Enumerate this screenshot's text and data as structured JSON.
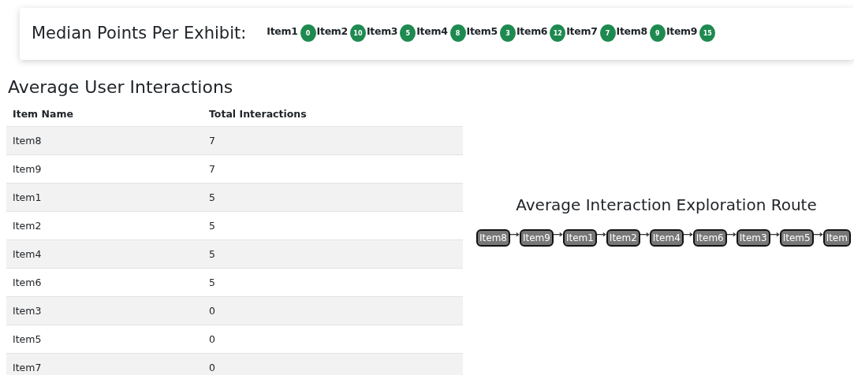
{
  "median_card": {
    "title": "Median Points Per Exhibit:",
    "items": [
      {
        "label": "Item1",
        "points": "0"
      },
      {
        "label": "Item2",
        "points": "10"
      },
      {
        "label": "Item3",
        "points": "5"
      },
      {
        "label": "Item4",
        "points": "8"
      },
      {
        "label": "Item5",
        "points": "3"
      },
      {
        "label": "Item6",
        "points": "12"
      },
      {
        "label": "Item7",
        "points": "7"
      },
      {
        "label": "Item8",
        "points": "9"
      },
      {
        "label": "Item9",
        "points": "15"
      }
    ]
  },
  "interactions": {
    "title": "Average User Interactions",
    "columns": [
      "Item Name",
      "Total Interactions"
    ],
    "rows": [
      [
        "Item8",
        "7"
      ],
      [
        "Item9",
        "7"
      ],
      [
        "Item1",
        "5"
      ],
      [
        "Item2",
        "5"
      ],
      [
        "Item4",
        "5"
      ],
      [
        "Item6",
        "5"
      ],
      [
        "Item3",
        "0"
      ],
      [
        "Item5",
        "0"
      ],
      [
        "Item7",
        "0"
      ]
    ]
  },
  "route": {
    "title": "Average Interaction Exploration Route",
    "nodes": [
      "Item8",
      "Item9",
      "Item1",
      "Item2",
      "Item4",
      "Item6",
      "Item3",
      "Item5",
      "Item"
    ]
  }
}
